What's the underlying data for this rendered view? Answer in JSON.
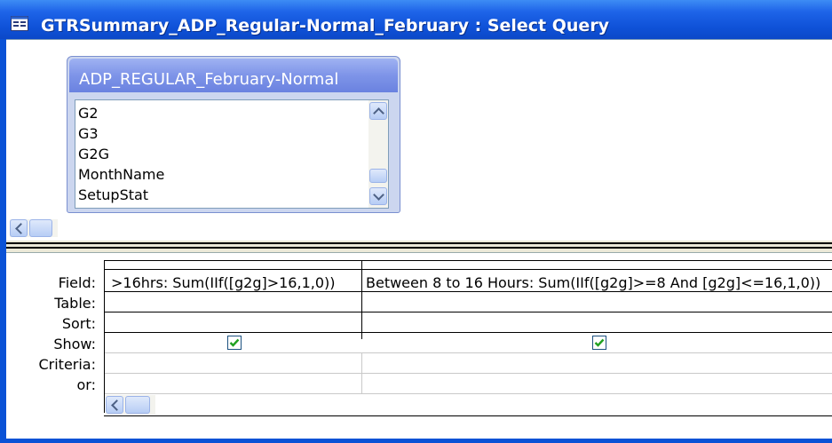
{
  "window": {
    "title": "GTRSummary_ADP_Regular-Normal_February : Select Query"
  },
  "field_list": {
    "table_name": "ADP_REGULAR_February-Normal",
    "fields": [
      "G2",
      "G3",
      "G2G",
      "MonthName",
      "SetupStat"
    ]
  },
  "grid": {
    "row_labels": [
      "Field:",
      "Table:",
      "Sort:",
      "Show:",
      "Criteria:",
      "or:"
    ],
    "columns": [
      {
        "field": ">16hrs: Sum(IIf([g2g]>16,1,0))",
        "table": "",
        "sort": "",
        "show": true,
        "criteria": "",
        "or": ""
      },
      {
        "field": "Between 8 to 16 Hours: Sum(IIf([g2g]>=8 And [g2g]<=16,1,0))",
        "table": "",
        "sort": "",
        "show": true,
        "criteria": "",
        "or": ""
      }
    ]
  },
  "colors": {
    "title_bar": "#0f52d8",
    "field_list_title": "#7e94e8",
    "checkbox_check": "#21a121"
  }
}
